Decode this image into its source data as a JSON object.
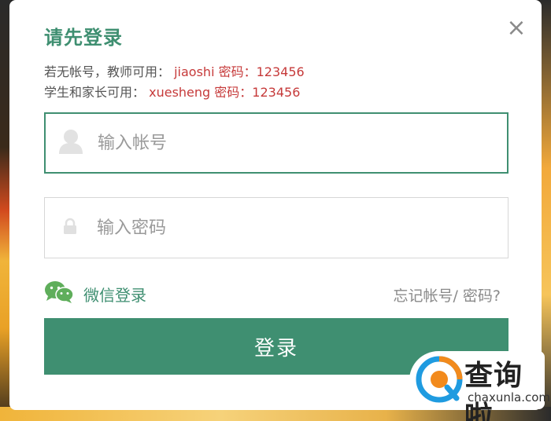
{
  "dialog": {
    "title": "请先登录",
    "close_glyph": "×",
    "hint_teacher": {
      "prefix": "若无帐号，教师可用：",
      "account": "jiaoshi",
      "password_label": "密码：",
      "password": "123456"
    },
    "hint_student": {
      "prefix": "学生和家长可用：",
      "account": "xuesheng",
      "password_label": "密码：",
      "password": "123456"
    },
    "username_field": {
      "placeholder": "输入帐号",
      "value": "",
      "icon": "user-icon"
    },
    "password_field": {
      "placeholder": "输入密码",
      "value": "",
      "icon": "lock-icon"
    },
    "wechat_login": {
      "label": "微信登录",
      "icon": "wechat-icon"
    },
    "forgot_link": "忘记帐号/ 密码?",
    "login_button": "登录"
  },
  "watermark": {
    "name_cn": "查询啦",
    "domain": "chaxunla.com"
  },
  "colors": {
    "accent": "#3f8f71",
    "highlight_red": "#c63a3a",
    "watermark_orange": "#f28a1c",
    "watermark_blue": "#1f9be0"
  }
}
